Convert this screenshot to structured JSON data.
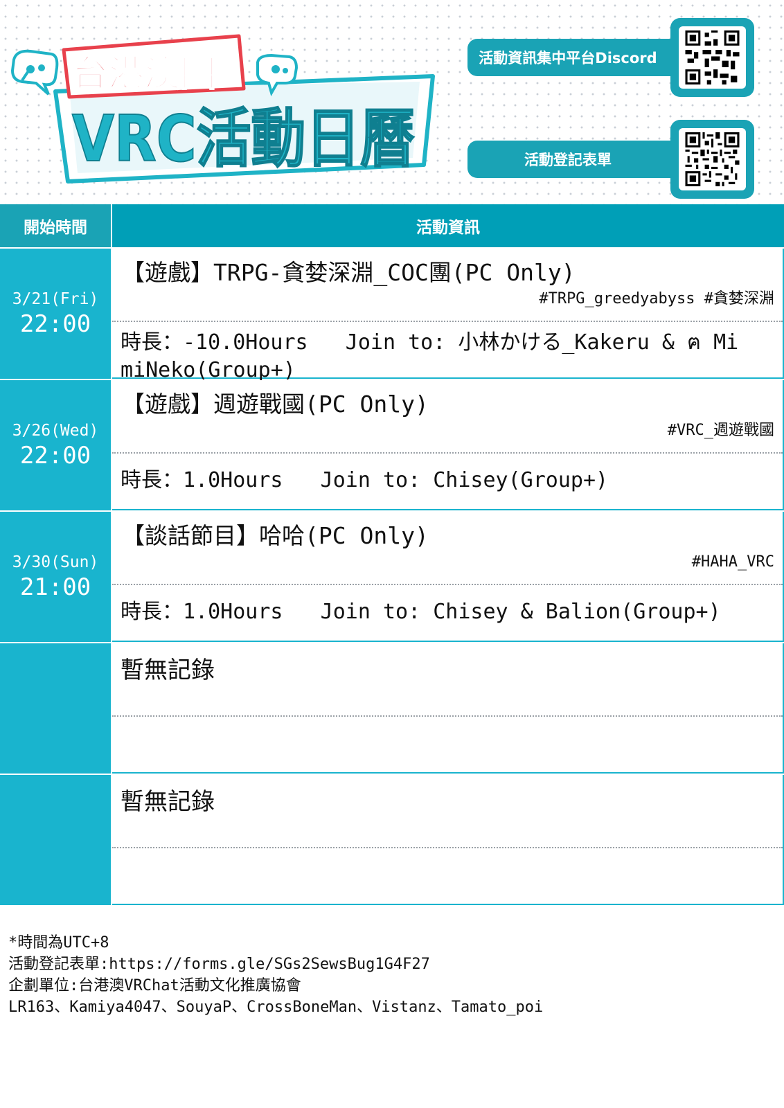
{
  "header": {
    "logo_top": "台港澳圈",
    "logo_main": "VRC活動日曆",
    "discord_label": "活動資訊集中平台Discord",
    "form_label": "活動登記表單",
    "discord_qr_icon": "qr-code-icon",
    "form_qr_icon": "qr-code-icon"
  },
  "colors": {
    "teal": "#19b4ce",
    "teal_dark": "#009fb7",
    "pill": "#1aa3b5",
    "logo_red": "#e8414c",
    "logo_teal": "#1fb3c6"
  },
  "table": {
    "col_time": "開始時間",
    "col_info": "活動資訊",
    "rows": [
      {
        "date": "3/21(Fri)",
        "time": "22:00",
        "title": "【遊戲】TRPG-貪婪深淵_COC團(PC Only)",
        "tags": "#TRPG_greedyabyss #貪婪深淵",
        "detail": "時長：-10.0Hours   Join to: 小林かける_Kakeru & ฅ MimiNeko(Group+)"
      },
      {
        "date": "3/26(Wed)",
        "time": "22:00",
        "title": "【遊戲】週遊戰國(PC Only)",
        "tags": "#VRC_週遊戰國",
        "detail": "時長：1.0Hours   Join to: Chisey(Group+)"
      },
      {
        "date": "3/30(Sun)",
        "time": "21:00",
        "title": "【談話節目】哈哈(PC Only)",
        "tags": "#HAHA_VRC",
        "detail": "時長：1.0Hours   Join to: Chisey & Balion(Group+)"
      },
      {
        "date": "",
        "time": "",
        "title": "暫無記錄",
        "tags": "",
        "detail": ""
      },
      {
        "date": "",
        "time": "",
        "title": "暫無記錄",
        "tags": "",
        "detail": ""
      }
    ]
  },
  "notes": {
    "timezone": "*時間為UTC+8",
    "form_link": "活動登記表單:https://forms.gle/SGs2SewsBug1G4F27",
    "organizer": "企劃單位:台港澳VRChat活動文化推廣協會",
    "staff": "LR163、Kamiya4047、SouyaP、CrossBoneMan、Vistanz、Tamato_poi"
  }
}
